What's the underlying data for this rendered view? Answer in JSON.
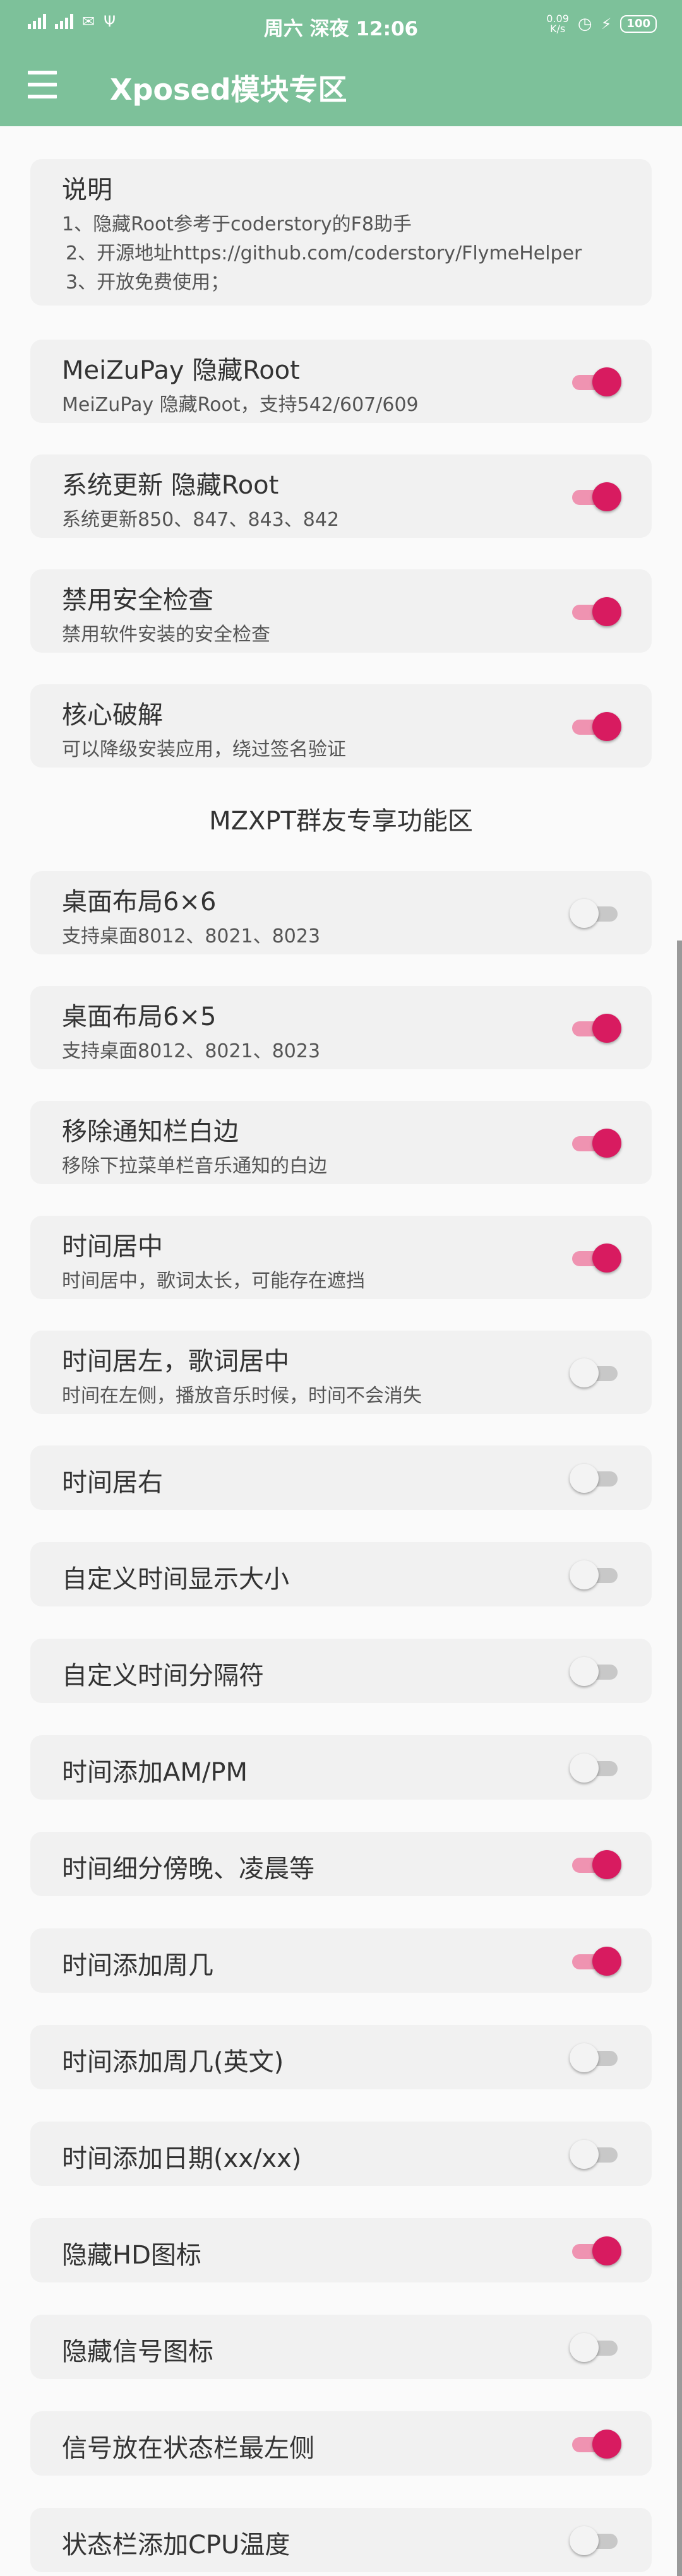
{
  "status_bar": {
    "datetime": "周六 深夜 12:06",
    "net_speed_line1": "0.09",
    "net_speed_line2": "K/s",
    "battery": "100"
  },
  "app_bar": {
    "title": "Xposed模块专区"
  },
  "description": {
    "title": "说明",
    "lines": [
      "1、隐藏Root参考于coderstory的F8助手",
      "2、开源地址https://github.com/coderstory/FlymeHelper",
      "3、开放免费使用；"
    ]
  },
  "section_title": "MZXPT群友专享功能区",
  "settings": [
    {
      "title": "MeiZuPay 隐藏Root",
      "subtitle": "MeiZuPay 隐藏Root，支持542/607/609",
      "enabled": true
    },
    {
      "title": "系统更新 隐藏Root",
      "subtitle": "系统更新850、847、843、842",
      "enabled": true
    },
    {
      "title": "禁用安全检查",
      "subtitle": "禁用软件安装的安全检查",
      "enabled": true
    },
    {
      "title": "核心破解",
      "subtitle": "可以降级安装应用，绕过签名验证",
      "enabled": true
    },
    {
      "title": "桌面布局6×6",
      "subtitle": "支持桌面8012、8021、8023",
      "enabled": false
    },
    {
      "title": "桌面布局6×5",
      "subtitle": "支持桌面8012、8021、8023",
      "enabled": true
    },
    {
      "title": "移除通知栏白边",
      "subtitle": "移除下拉菜单栏音乐通知的白边",
      "enabled": true
    },
    {
      "title": "时间居中",
      "subtitle": "时间居中，歌词太长，可能存在遮挡",
      "enabled": true
    },
    {
      "title": "时间居左，歌词居中",
      "subtitle": "时间在左侧，播放音乐时候，时间不会消失",
      "enabled": false
    },
    {
      "title": "时间居右",
      "subtitle": "",
      "enabled": false
    },
    {
      "title": "自定义时间显示大小",
      "subtitle": "",
      "enabled": false
    },
    {
      "title": "自定义时间分隔符",
      "subtitle": "",
      "enabled": false
    },
    {
      "title": "时间添加AM/PM",
      "subtitle": "",
      "enabled": false
    },
    {
      "title": "时间细分傍晚、凌晨等",
      "subtitle": "",
      "enabled": true
    },
    {
      "title": "时间添加周几",
      "subtitle": "",
      "enabled": true
    },
    {
      "title": "时间添加周几(英文)",
      "subtitle": "",
      "enabled": false
    },
    {
      "title": "时间添加日期(xx/xx)",
      "subtitle": "",
      "enabled": false
    },
    {
      "title": "隐藏HD图标",
      "subtitle": "",
      "enabled": true
    },
    {
      "title": "隐藏信号图标",
      "subtitle": "",
      "enabled": false
    },
    {
      "title": "信号放在状态栏最左侧",
      "subtitle": "",
      "enabled": true
    },
    {
      "title": "状态栏添加CPU温度",
      "subtitle": "",
      "enabled": false
    }
  ],
  "colors": {
    "accent": "#7dc19a",
    "toggle_on": "#d81b60",
    "toggle_on_track": "#ef93b1",
    "toggle_off_track": "#c8c8c8"
  }
}
